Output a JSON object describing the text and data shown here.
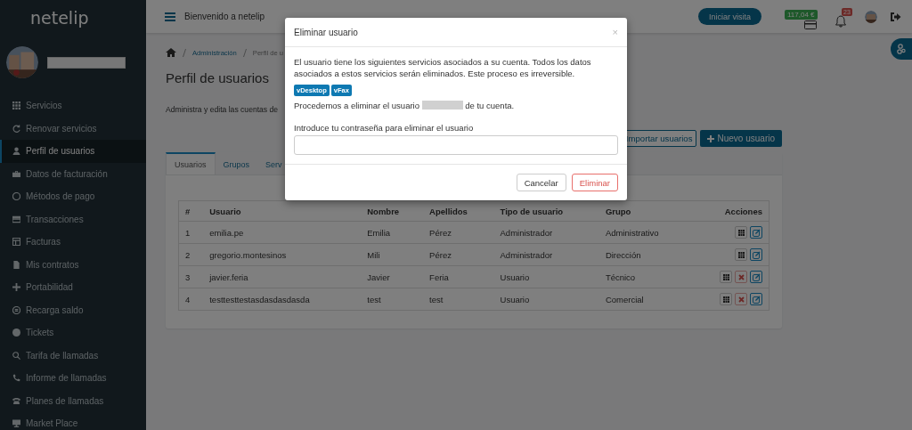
{
  "sidebar": {
    "logo": "netelip",
    "items": [
      {
        "label": "Servicios",
        "selected": false
      },
      {
        "label": "Renovar servicios",
        "selected": false
      },
      {
        "label": "Perfil de usuarios",
        "selected": true
      },
      {
        "label": "Datos de facturación",
        "selected": false
      },
      {
        "label": "Métodos de pago",
        "selected": false
      },
      {
        "label": "Transacciones",
        "selected": false
      },
      {
        "label": "Facturas",
        "selected": false
      },
      {
        "label": "Mis contratos",
        "selected": false
      },
      {
        "label": "Portabilidad",
        "selected": false
      },
      {
        "label": "Recarga saldo",
        "selected": false
      },
      {
        "label": "Tickets",
        "selected": false
      },
      {
        "label": "Tarifa de llamadas",
        "selected": false
      },
      {
        "label": "Informe de llamadas",
        "selected": false
      },
      {
        "label": "Planes de llamadas",
        "selected": false
      },
      {
        "label": "Market Place",
        "selected": false
      }
    ]
  },
  "topbar": {
    "greeting": "Bienvenido a netelip",
    "visit_button": "Iniciar visita",
    "balance": "117,04 €",
    "notifications": "23"
  },
  "breadcrumb": [
    "Administración",
    "Perfil de u"
  ],
  "page": {
    "title": "Perfil de usuarios",
    "description": "Administra y edita las cuentas de",
    "import_button": "Importar usuarios",
    "new_button": "Nuevo usuario"
  },
  "tabs": [
    {
      "label": "Usuarios",
      "selected": true
    },
    {
      "label": "Grupos",
      "selected": false
    },
    {
      "label": "Serv",
      "selected": false
    }
  ],
  "table": {
    "columns": [
      "#",
      "Usuario",
      "Nombre",
      "Apellidos",
      "Tipo de usuario",
      "Grupo",
      "Acciones"
    ],
    "rows": [
      {
        "cells": [
          "1",
          "emilia.pe",
          "Emilia",
          "Pérez",
          "Administrador",
          "Administrativo"
        ],
        "deletable": false
      },
      {
        "cells": [
          "2",
          "gregorio.montesinos",
          "Mili",
          "Pérez",
          "Administrador",
          "Dirección"
        ],
        "deletable": false
      },
      {
        "cells": [
          "3",
          "javier.feria",
          "Javier",
          "Feria",
          "Usuario",
          "Técnico"
        ],
        "deletable": true
      },
      {
        "cells": [
          "4",
          "testtesttestasdasdasdasda",
          "test",
          "test",
          "Usuario",
          "Comercial"
        ],
        "deletable": true
      }
    ]
  },
  "modal": {
    "title": "Eliminar usuario",
    "close": "×",
    "message": "El usuario tiene los siguientes servicios asociados a su cuenta. Todos los datos asociados a estos servicios serán eliminados. Este proceso es irreversible.",
    "services": [
      "vDesktop",
      "vFax"
    ],
    "confirm_before": "Procedemos a eliminar el usuario",
    "confirm_after": "de tu cuenta.",
    "password_label": "Introduce tu contraseña para eliminar el usuario",
    "cancel_button": "Cancelar",
    "delete_button": "Eliminar"
  }
}
